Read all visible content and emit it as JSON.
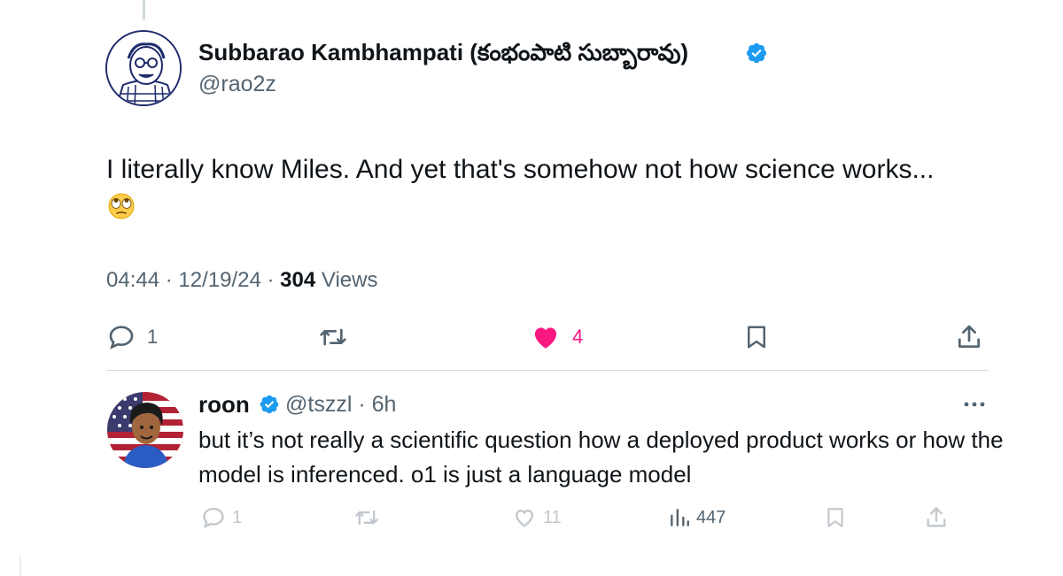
{
  "main_tweet": {
    "author_name": "Subbarao Kambhampati (కంభంపాటి సుబ్బారావు)",
    "handle": "@rao2z",
    "text": "I literally know Miles. And yet that's somehow not how science works...",
    "emoji": "face-with-rolling-eyes",
    "time": "04:44",
    "separator": "·",
    "date": "12/19/24",
    "views_count": "304",
    "views_label": "Views",
    "actions": {
      "reply_count": "1",
      "like_count": "4"
    },
    "colors": {
      "like": "#f91880",
      "verified": "#1d9bf0",
      "muted": "#536471"
    }
  },
  "reply": {
    "author_name": "roon",
    "handle_time": "@tszzl · 6h",
    "text": "but it’s not really a scientific question how a deployed product works or how the model is inferenced. o1 is just a language model",
    "actions": {
      "reply_count": "1",
      "like_count": "11",
      "views_count": "447"
    }
  }
}
